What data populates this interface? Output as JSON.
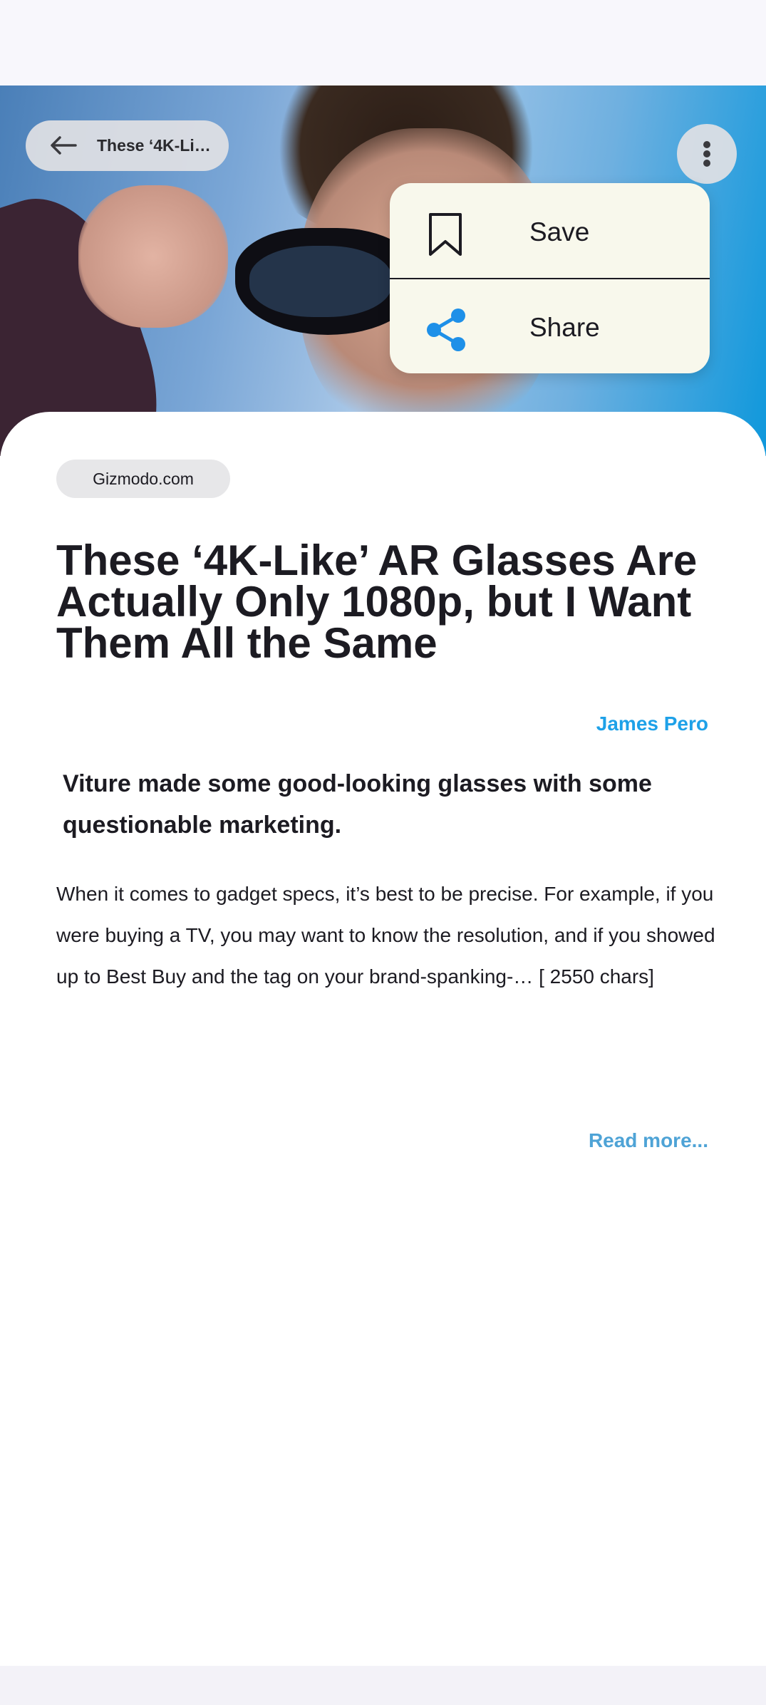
{
  "header": {
    "back_title": "These ‘4K-Li…"
  },
  "menu": {
    "items": [
      {
        "label": "Save",
        "icon": "bookmark-icon"
      },
      {
        "label": "Share",
        "icon": "share-icon",
        "icon_color": "#1e90e8"
      }
    ]
  },
  "article": {
    "source": "Gizmodo.com",
    "title": "These ‘4K-Like’ AR Glasses Are Actually Only 1080p, but I Want Them All the Same",
    "author": "James Pero",
    "subtitle": "Viture made some good-looking glasses with some questionable marketing.",
    "body": "When it comes to gadget specs, it’s best to be precise. For example, if you were buying a TV, you may want to know the resolution, and if you showed up to Best Buy and the tag on your brand-spanking-… [ 2550 chars]",
    "read_more": "Read more..."
  },
  "colors": {
    "accent": "#1ea1e8",
    "read_more": "#4ea3d6",
    "background": "#f8f7fc"
  }
}
